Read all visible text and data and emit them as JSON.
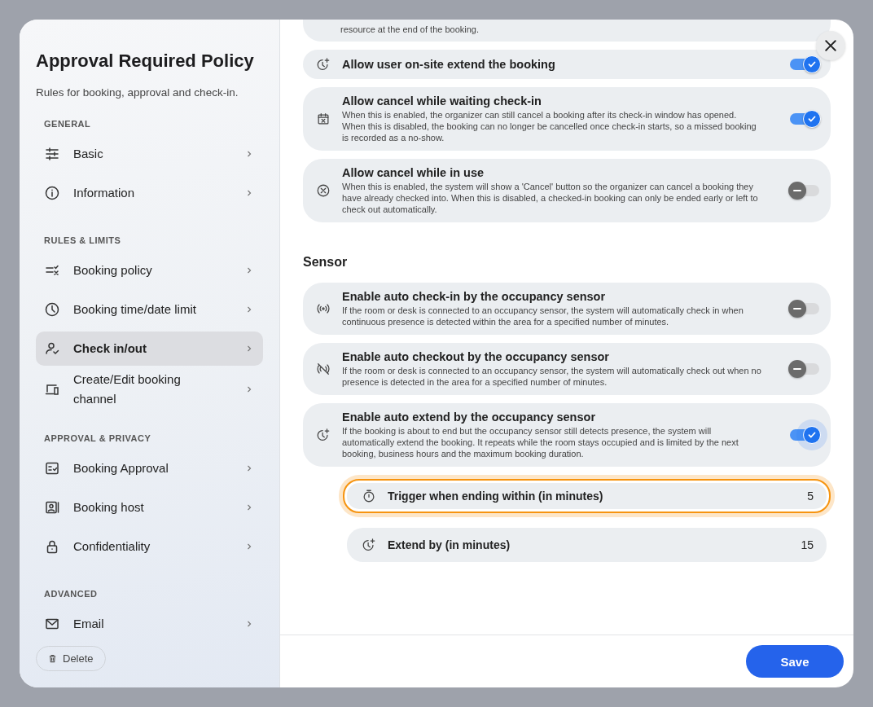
{
  "sidebar": {
    "title": "Approval Required Policy",
    "subtitle": "Rules for booking, approval and check-in.",
    "sections": [
      {
        "label": "GENERAL",
        "items": [
          {
            "label": "Basic",
            "selected": false
          },
          {
            "label": "Information",
            "selected": false
          }
        ]
      },
      {
        "label": "RULES & LIMITS",
        "items": [
          {
            "label": "Booking policy",
            "selected": false
          },
          {
            "label": "Booking time/date limit",
            "selected": false
          },
          {
            "label": "Check in/out",
            "selected": true
          },
          {
            "label": "Create/Edit booking channel",
            "selected": false
          }
        ]
      },
      {
        "label": "APPROVAL & PRIVACY",
        "items": [
          {
            "label": "Booking Approval",
            "selected": false
          },
          {
            "label": "Booking host",
            "selected": false
          },
          {
            "label": "Confidentiality",
            "selected": false
          }
        ]
      },
      {
        "label": "ADVANCED",
        "items": [
          {
            "label": "Email",
            "selected": false
          }
        ]
      }
    ],
    "delete_button": "Delete"
  },
  "content": {
    "cut_card_text": "resource at the end of the booking.",
    "groups": [
      {
        "settings": [
          {
            "kind": "toggle",
            "title": "Allow user on-site extend the booking",
            "on": true,
            "focused": false
          },
          {
            "kind": "toggle",
            "title": "Allow cancel while waiting check-in",
            "description": "When this is enabled, the organizer can still cancel a booking after its check-in window has opened. When this is disabled, the booking can no longer be cancelled once check-in starts, so a missed booking is recorded as a no-show.",
            "on": true,
            "focused": false
          },
          {
            "kind": "toggle",
            "title": "Allow cancel while in use",
            "description": "When this is enabled, the system will show a 'Cancel' button so the organizer can cancel a booking they have already checked into. When this is disabled, a checked-in booking can only be ended early or left to check out automatically.",
            "on": false,
            "focused": false
          }
        ]
      },
      {
        "heading": "Sensor",
        "settings": [
          {
            "kind": "toggle",
            "title": "Enable auto check-in by the occupancy sensor",
            "description": "If the room or desk is connected to an occupancy sensor, the system will automatically check in when continuous presence is detected within the area for a specified number of minutes.",
            "on": false,
            "focused": false
          },
          {
            "kind": "toggle",
            "title": "Enable auto checkout by the occupancy sensor",
            "description": "If the room or desk is connected to an occupancy sensor, the system will automatically check out when no presence is detected in the area for a specified number of minutes.",
            "on": false,
            "focused": false
          },
          {
            "kind": "toggle",
            "title": "Enable auto extend by the occupancy sensor",
            "description": "If the booking is about to end but the occupancy sensor still detects presence, the system will automatically extend the booking. It repeats while the room stays occupied and is limited by the next booking, business hours and the maximum booking duration.",
            "on": true,
            "focused": true,
            "children": [
              {
                "kind": "number",
                "title": "Trigger when ending within (in minutes)",
                "value": "5",
                "highlighted": true
              },
              {
                "kind": "number",
                "title": "Extend by (in minutes)",
                "value": "15",
                "highlighted": false
              }
            ]
          }
        ]
      }
    ]
  },
  "save_button": "Save"
}
